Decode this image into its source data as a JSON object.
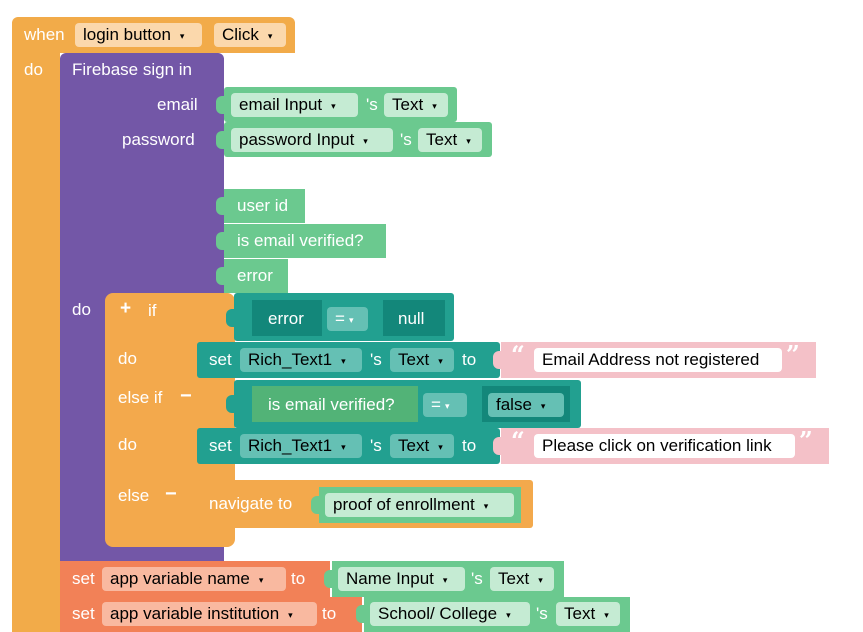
{
  "event": {
    "when_label": "when",
    "component": "login button",
    "event_name": "Click",
    "do_label": "do"
  },
  "firebase": {
    "title": "Firebase sign in",
    "email_label": "email",
    "email_component": "email  Input",
    "email_property": "Text",
    "password_label": "password",
    "password_component": "password  Input",
    "password_property": "Text",
    "possessive": "'s",
    "outputs": [
      "user id",
      "is email verified?",
      "error"
    ],
    "do_label": "do"
  },
  "if_block": {
    "plus": "+",
    "if_label": "if",
    "cond1_var": "error",
    "cond1_op": "=",
    "cond1_value": "null",
    "do_label": "do",
    "set1": {
      "set_label": "set",
      "component": "Rich_Text1",
      "possessive": "'s",
      "property": "Text",
      "to_label": "to",
      "text": "Email Address not registered"
    },
    "elseif_label": "else if",
    "minus": "−",
    "cond2_var": "is email verified?",
    "cond2_op": "=",
    "cond2_value": "false",
    "do2_label": "do",
    "set2": {
      "set_label": "set",
      "component": "Rich_Text1",
      "possessive": "'s",
      "property": "Text",
      "to_label": "to",
      "text": "Please click on verification link"
    },
    "else_label": "else",
    "navigate_label": "navigate to",
    "navigate_target": "proof of enrollment"
  },
  "app_vars": [
    {
      "set_label": "set",
      "variable": "app variable name",
      "to_label": "to",
      "component": "Name Input",
      "possessive": "'s",
      "property": "Text"
    },
    {
      "set_label": "set",
      "variable": "app variable institution",
      "to_label": "to",
      "component": "School/ College",
      "possessive": "'s",
      "property": "Text"
    }
  ],
  "quote_open": "“",
  "quote_close": "”",
  "caret": "▾",
  "colors": {
    "event": "#f2ab49",
    "firebase": "#7357a7",
    "if_block": "#f3a94c",
    "component_getter": "#6bc98f",
    "set_block": "#22a090",
    "text_literal": "#f4c1c8",
    "app_variable": "#f28157"
  }
}
